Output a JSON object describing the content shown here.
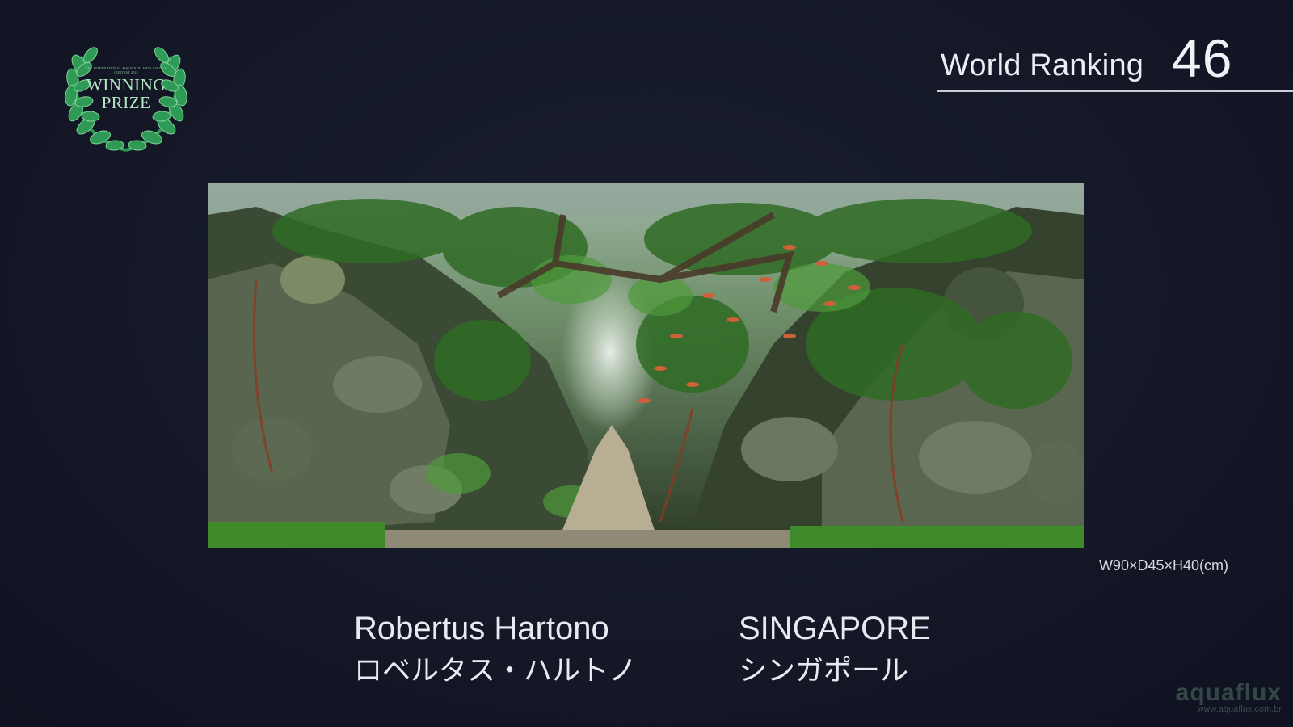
{
  "badge": {
    "small_text": "THE INTERNATIONAL AQUATIC PLANTS LAYOUT CONTEST 2015",
    "line1": "WINNING",
    "line2": "PRIZE"
  },
  "ranking": {
    "label": "World Ranking",
    "value": "46"
  },
  "photo": {
    "description_icon": "aquascape-photo"
  },
  "dimensions": "W90×D45×H40(cm)",
  "entrant": {
    "name_en": "Robertus Hartono",
    "name_jp": "ロベルタス・ハルトノ",
    "country_en": "SINGAPORE",
    "country_jp": "シンガポール"
  },
  "watermark": {
    "logo": "aquaflux",
    "url": "www.aquaflux.com.br"
  },
  "colors": {
    "background": "#141827",
    "badge_green": "#2e9a55",
    "text": "#e8eaf0"
  }
}
